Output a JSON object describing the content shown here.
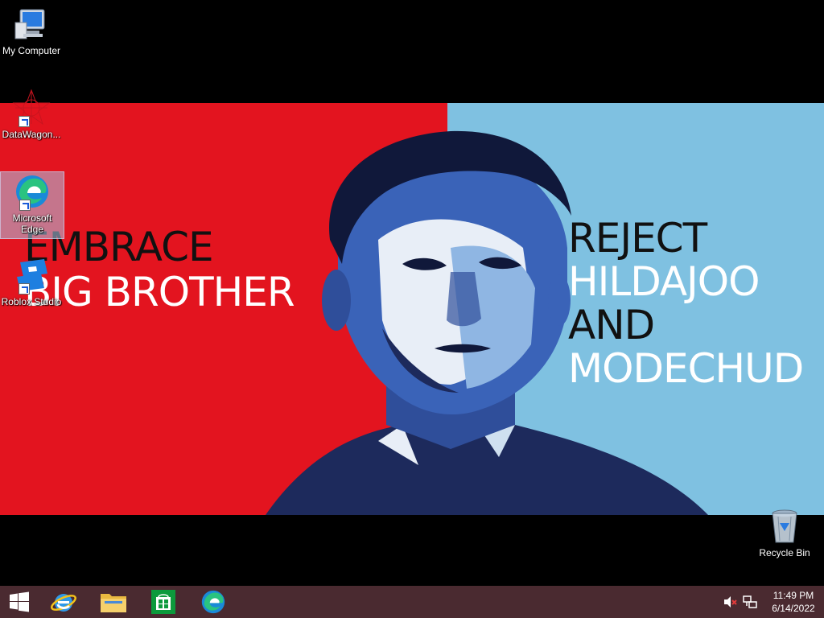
{
  "desktop": {
    "icons": [
      {
        "label": "My Computer"
      },
      {
        "label": "DataWagon..."
      },
      {
        "label": "Microsoft Edge"
      },
      {
        "label": "Roblox Studio"
      },
      {
        "label": "Recycle Bin"
      }
    ]
  },
  "wallpaper": {
    "left_lines": [
      "EMBRACE",
      "BIG BROTHER"
    ],
    "right_lines": [
      "REJECT",
      "HILDAJOO",
      "AND",
      "MODECHUD"
    ],
    "colors": {
      "red": "#e3141f",
      "blue": "#7fc1e1",
      "navy": "#1d2a5c"
    }
  },
  "taskbar": {
    "pinned": [
      "internet-explorer",
      "file-explorer",
      "store",
      "microsoft-edge"
    ],
    "clock": {
      "time": "11:49 PM",
      "date": "6/14/2022"
    },
    "color": "#4a2a30"
  }
}
